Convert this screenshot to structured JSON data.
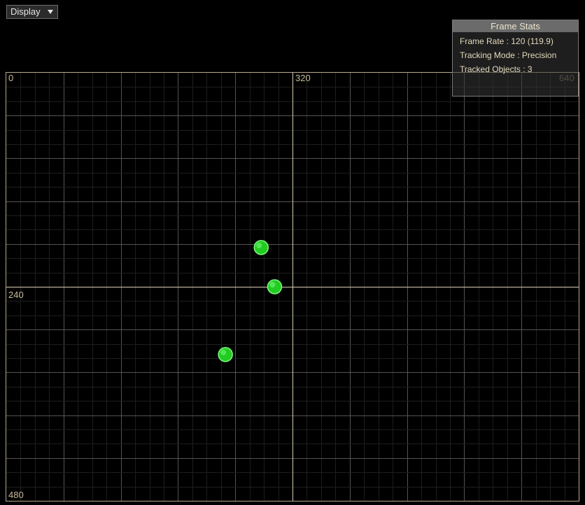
{
  "toolbar": {
    "display_label": "Display"
  },
  "tracking_area": {
    "x_range": [
      0,
      640
    ],
    "y_range": [
      0,
      480
    ],
    "labels": {
      "x0": "0",
      "x320": "320",
      "x640": "640",
      "y240": "240",
      "y480": "480"
    },
    "objects": [
      {
        "x": 285,
        "y": 196
      },
      {
        "x": 300,
        "y": 240
      },
      {
        "x": 245,
        "y": 316
      }
    ],
    "colors": {
      "grid_minor": "#1e1e1e",
      "grid_major": "#575450",
      "axis": "#d8cfb4",
      "object_fill": "#22cc22",
      "object_highlight": "#7dfa7d"
    }
  },
  "stats": {
    "title": "Frame Stats",
    "frame_rate": "Frame Rate : 120 (119.9)",
    "tracking_mode": "Tracking Mode : Precision",
    "tracked_objects": "Tracked Objects : 3"
  }
}
